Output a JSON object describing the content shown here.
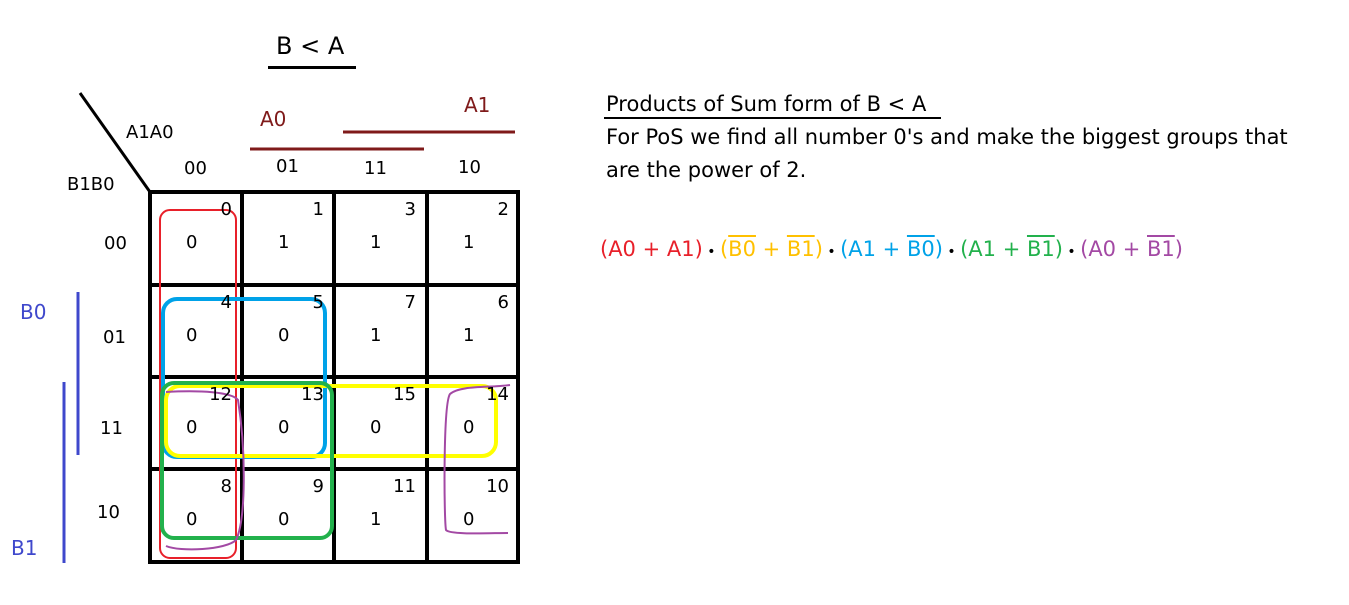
{
  "title": "B < A",
  "labels": {
    "a0": "A0",
    "a1": "A1",
    "b0": "B0",
    "b1": "B1",
    "col_var": "A1A0",
    "row_var": "B1B0"
  },
  "col_headers": [
    "00",
    "01",
    "11",
    "10"
  ],
  "row_headers": [
    "00",
    "01",
    "11",
    "10"
  ],
  "cells": [
    [
      {
        "idx": "0",
        "val": "0"
      },
      {
        "idx": "1",
        "val": "1"
      },
      {
        "idx": "3",
        "val": "1"
      },
      {
        "idx": "2",
        "val": "1"
      }
    ],
    [
      {
        "idx": "4",
        "val": "0"
      },
      {
        "idx": "5",
        "val": "0"
      },
      {
        "idx": "7",
        "val": "1"
      },
      {
        "idx": "6",
        "val": "1"
      }
    ],
    [
      {
        "idx": "12",
        "val": "0"
      },
      {
        "idx": "13",
        "val": "0"
      },
      {
        "idx": "15",
        "val": "0"
      },
      {
        "idx": "14",
        "val": "0"
      }
    ],
    [
      {
        "idx": "8",
        "val": "0"
      },
      {
        "idx": "9",
        "val": "0"
      },
      {
        "idx": "11",
        "val": "1"
      },
      {
        "idx": "10",
        "val": "0"
      }
    ]
  ],
  "heading": "Products of Sum form of B < A",
  "description_lines": [
    "For PoS we find all number 0's and make the biggest groups that",
    "are the power of 2."
  ],
  "expression": {
    "dot": " • ",
    "terms": [
      {
        "color": "#e8202a",
        "parts": [
          {
            "t": "(A0 + A1)",
            "bar": false
          }
        ]
      },
      {
        "color": "#ffc000",
        "parts": [
          {
            "t": "(",
            "bar": false
          },
          {
            "t": "B0",
            "bar": true
          },
          {
            "t": " + ",
            "bar": false
          },
          {
            "t": "B1",
            "bar": true
          },
          {
            "t": ")",
            "bar": false
          }
        ]
      },
      {
        "color": "#00a2e8",
        "parts": [
          {
            "t": "(A1 + ",
            "bar": false
          },
          {
            "t": "B0",
            "bar": true
          },
          {
            "t": ")",
            "bar": false
          }
        ]
      },
      {
        "color": "#22b14c",
        "parts": [
          {
            "t": "(A1 + ",
            "bar": false
          },
          {
            "t": "B1",
            "bar": true
          },
          {
            "t": ")",
            "bar": false
          }
        ]
      },
      {
        "color": "#a349a4",
        "parts": [
          {
            "t": "(A0 + ",
            "bar": false
          },
          {
            "t": "B1",
            "bar": true
          },
          {
            "t": ")",
            "bar": false
          }
        ]
      }
    ]
  },
  "colors": {
    "title_a": "#7f1a1a",
    "title_b": "#3f48cc",
    "group_red": "#e8202a",
    "group_blue": "#00a2e8",
    "group_yellow": "#ffff00",
    "group_green": "#22b14c",
    "group_purple": "#a349a4"
  }
}
